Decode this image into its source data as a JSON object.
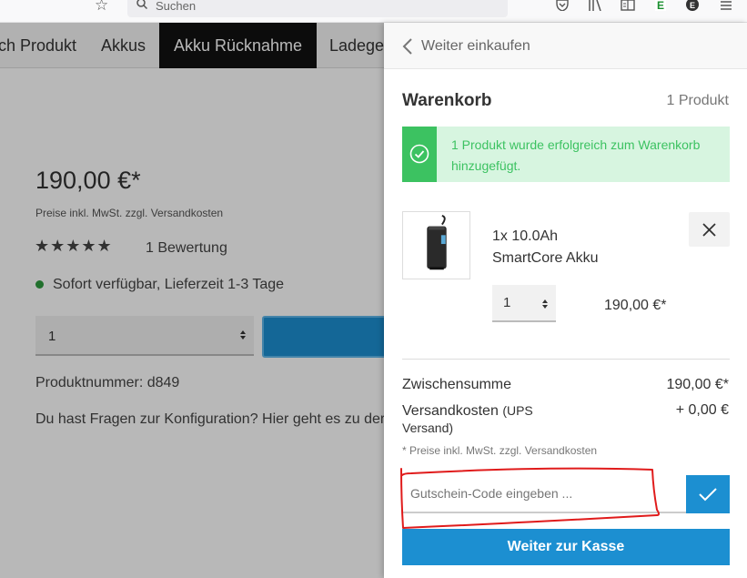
{
  "browser": {
    "search_placeholder": "Suchen",
    "icons": [
      "bookmark-star-icon",
      "search-icon",
      "shield-icon",
      "library-icon",
      "reader-view-icon",
      "extension-e-icon",
      "account-e-icon",
      "menu-icon"
    ]
  },
  "nav": {
    "items": [
      {
        "label": "ch Produkt"
      },
      {
        "label": "Akkus"
      },
      {
        "label": "Akku Rücknahme"
      },
      {
        "label": "Ladege"
      }
    ],
    "active_index": 2
  },
  "product": {
    "price": "190,00 €*",
    "price_note": "Preise inkl. MwSt. zzgl. Versandkosten",
    "stars": "★★★★★",
    "rating_count": "1 Bewertung",
    "availability": "Sofort verfügbar, Lieferzeit 1-3 Tage",
    "quantity": "1",
    "product_number": "Produktnummer: d849",
    "config_question": "Du hast Fragen zur Konfiguration? Hier geht es zu der"
  },
  "cart": {
    "back_label": "Weiter einkaufen",
    "title": "Warenkorb",
    "count": "1 Produkt",
    "success_message": "1 Produkt wurde erfolgreich zum Warenkorb hinzugefügt.",
    "item": {
      "qty_name": "1x 10.0Ah",
      "name": "SmartCore Akku",
      "quantity": "1",
      "price": "190,00 €*"
    },
    "subtotal_label": "Zwischensumme",
    "subtotal_value": "190,00 €*",
    "shipping_label": "Versandkosten",
    "shipping_sub": "(UPS Versand)",
    "shipping_value": "+ 0,00 €",
    "tax_note": "* Preise inkl. MwSt. zzgl. Versandkosten",
    "voucher_placeholder": "Gutschein-Code eingeben ...",
    "checkout_label": "Weiter zur Kasse"
  },
  "colors": {
    "primary": "#1c8fd1",
    "success": "#3cc261",
    "success_bg": "#d7f5e0",
    "annotation_red": "#e01b1b"
  }
}
